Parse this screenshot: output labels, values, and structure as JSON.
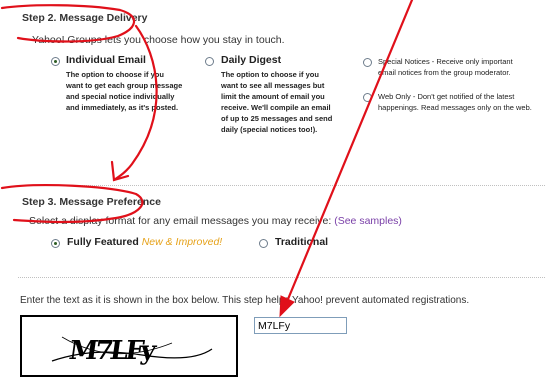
{
  "delivery": {
    "title": "Step 2. Message Delivery",
    "intro": "Yahoo! Groups lets you choose how you stay in touch.",
    "options": [
      {
        "label": "Individual Email",
        "checked": true,
        "description": [
          "The option to choose if you",
          "want to get each group message",
          "and special notice individually",
          "and immediately, as it's posted."
        ]
      },
      {
        "label": "Daily Digest",
        "checked": false,
        "description": [
          "The option to choose if you",
          "want to see all messages but",
          "limit the amount of email you",
          "receive. We'll compile an email",
          "of up to 25 messages and send",
          "daily (special notices too!)."
        ]
      },
      {
        "label": "Special Notices",
        "label_suffix": " - Receive only important",
        "checked": false,
        "description": [
          "email notices from the group moderator."
        ]
      },
      {
        "label": "Web Only",
        "label_suffix": " - Don't get notified of the latest",
        "checked": false,
        "description": [
          "happenings. Read messages only on the web."
        ]
      }
    ]
  },
  "preference": {
    "title": "Step 3. Message Preference",
    "intro": "Select a display format for any email messages you may receive: ",
    "samples_link": "(See samples)",
    "options": [
      {
        "label": "Fully Featured",
        "tag": "New & Improved!",
        "checked": true
      },
      {
        "label": "Traditional",
        "checked": false
      }
    ]
  },
  "verification": {
    "instruction": "Enter the text as it is shown in the box below. This step helps Yahoo! prevent automated registrations.",
    "captcha_text": "M7LFy",
    "input_value": "M7LFy"
  },
  "colors": {
    "annotation": "#e0101a",
    "link": "#7a40a8",
    "new_tag": "#e6a21a"
  }
}
